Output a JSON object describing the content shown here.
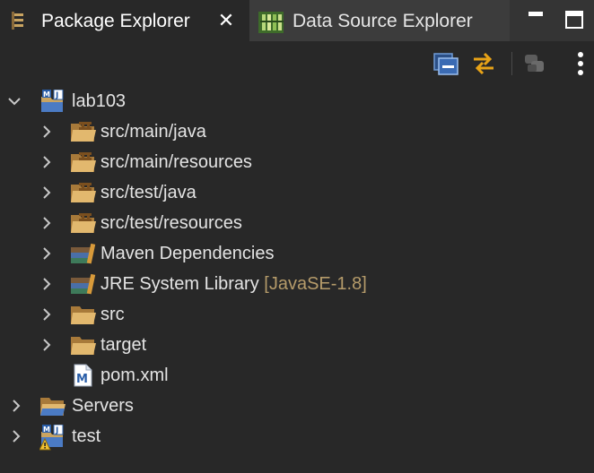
{
  "tabs": [
    {
      "label": "Package Explorer",
      "icon": "package-explorer-icon",
      "active": true
    },
    {
      "label": "Data Source Explorer",
      "icon": "data-source-explorer-icon",
      "active": false
    }
  ],
  "window_buttons": [
    "minimize-icon",
    "maximize-icon"
  ],
  "toolbar": [
    "collapse-all-icon",
    "link-with-editor-icon",
    "filter-icon",
    "view-menu-icon"
  ],
  "tree": [
    {
      "label": "lab103",
      "expanded": true,
      "icon": "maven-project-icon"
    },
    {
      "label": "src/main/java",
      "icon": "source-folder-icon"
    },
    {
      "label": "src/main/resources",
      "icon": "source-folder-icon"
    },
    {
      "label": "src/test/java",
      "icon": "source-folder-icon"
    },
    {
      "label": "src/test/resources",
      "icon": "source-folder-icon"
    },
    {
      "label": "Maven Dependencies",
      "icon": "library-icon"
    },
    {
      "label": "JRE System Library",
      "decoration": "[JavaSE-1.8]",
      "icon": "library-icon"
    },
    {
      "label": "src",
      "icon": "folder-icon"
    },
    {
      "label": "target",
      "icon": "folder-icon"
    },
    {
      "label": "pom.xml",
      "icon": "maven-file-icon"
    },
    {
      "label": "Servers",
      "icon": "project-folder-icon"
    },
    {
      "label": "test",
      "icon": "maven-project-warning-icon"
    }
  ]
}
